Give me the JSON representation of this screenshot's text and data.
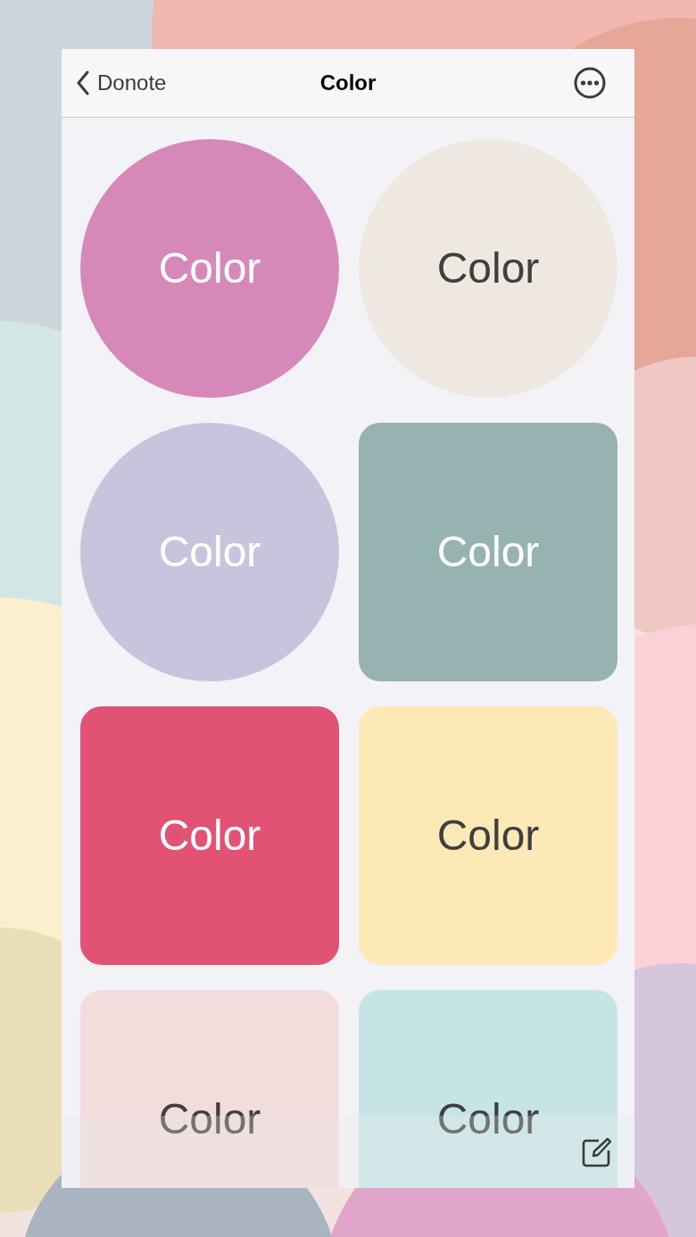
{
  "nav_bar": {
    "back_label": "Donote",
    "title": "Color"
  },
  "tiles": [
    {
      "kind": "circle",
      "color": "#d689b8",
      "label": "Color"
    },
    {
      "kind": "circle",
      "color": "#efe8e0",
      "label": "Color"
    },
    {
      "kind": "circle",
      "color": "#c8c4de",
      "label": "Color"
    },
    {
      "kind": "square",
      "color": "#97b3b1",
      "label": "Color"
    },
    {
      "kind": "square",
      "color": "#e25274",
      "label": "Color"
    },
    {
      "kind": "square",
      "color": "#fde9b5",
      "label": "Color"
    },
    {
      "kind": "square",
      "color": "#f3dcdc",
      "label": "Color"
    },
    {
      "kind": "square",
      "color": "#c6e4e6",
      "label": "Color"
    }
  ]
}
